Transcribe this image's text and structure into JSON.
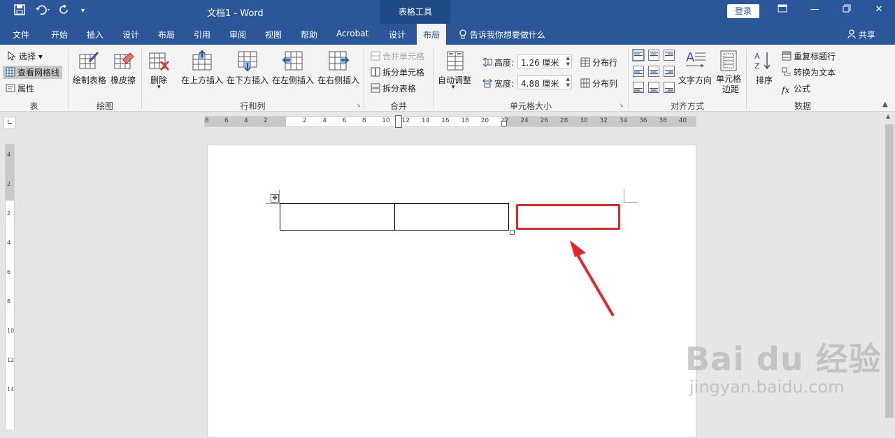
{
  "titlebar": {
    "doc_title": "文档1  -  Word",
    "context_tab_group": "表格工具",
    "login_label": "登录"
  },
  "tabs": [
    "文件",
    "开始",
    "插入",
    "设计",
    "布局",
    "引用",
    "审阅",
    "视图",
    "帮助",
    "Acrobat"
  ],
  "context_tabs": {
    "design": "设计",
    "layout": "布局"
  },
  "tell_me": "告诉我你想要做什么",
  "share": "共享",
  "ribbon": {
    "table": {
      "select": "选择",
      "view_gridlines": "查看网格线",
      "properties": "属性",
      "label": "表"
    },
    "draw": {
      "draw_table": "绘制表格",
      "eraser": "橡皮擦",
      "label": "绘图"
    },
    "rows_cols": {
      "delete": "删除",
      "insert_above": "在上方插入",
      "insert_below": "在下方插入",
      "insert_left": "在左侧插入",
      "insert_right": "在右侧插入",
      "label": "行和列"
    },
    "merge": {
      "merge_cells": "合并单元格",
      "split_cells": "拆分单元格",
      "split_table": "拆分表格",
      "label": "合并"
    },
    "cell_size": {
      "autofit": "自动调整",
      "height_label": "高度:",
      "height_value": "1.26 厘米",
      "width_label": "宽度:",
      "width_value": "4.88 厘米",
      "distribute_rows": "分布行",
      "distribute_cols": "分布列",
      "label": "单元格大小"
    },
    "alignment": {
      "text_direction": "文字方向",
      "cell_margins_1": "单元格",
      "cell_margins_2": "边距",
      "label": "对齐方式"
    },
    "data": {
      "sort": "排序",
      "repeat_header": "重复标题行",
      "convert_to_text": "转换为文本",
      "formula": "公式",
      "label": "数据"
    }
  },
  "ruler": {
    "h_left_numbers": [
      "8",
      "6",
      "4",
      "2"
    ],
    "h_numbers": [
      "2",
      "4",
      "6",
      "8",
      "10",
      "12",
      "14",
      "16",
      "18",
      "20",
      "22",
      "24",
      "26",
      "28",
      "30",
      "32",
      "34",
      "36",
      "38",
      "40"
    ],
    "v_numbers": [
      "4",
      "2",
      "2",
      "4",
      "6",
      "8",
      "10",
      "12",
      "14"
    ]
  },
  "watermark": {
    "logo": "Bai du 经验",
    "url": "jingyan.baidu.com"
  },
  "colors": {
    "brand": "#2b579a",
    "highlight": "#e8242a"
  }
}
